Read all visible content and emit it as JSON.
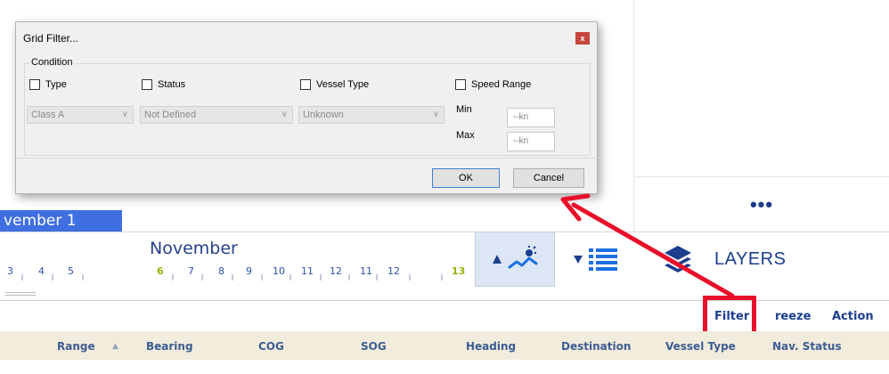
{
  "dialog": {
    "title": "Grid Filter...",
    "close_glyph": "x",
    "group_label": "Condition",
    "checkboxes": {
      "type": "Type",
      "status": "Status",
      "vessel_type": "Vessel Type",
      "speed_range": "Speed Range"
    },
    "combos": {
      "type": "Class A",
      "status": "Not Defined",
      "vessel_type": "Unknown"
    },
    "min_label": "Min",
    "max_label": "Max",
    "min_value": "--kn",
    "max_value": "--kn",
    "ok_label": "OK",
    "cancel_label": "Cancel"
  },
  "date_bar": {
    "selected_date": "vember 1"
  },
  "timeline": {
    "month": "November",
    "days": [
      "3",
      "4",
      "5",
      "6",
      "7",
      "8",
      "9",
      "10",
      "11",
      "12",
      "13"
    ],
    "highlighted_days": [
      "6",
      "13"
    ]
  },
  "side_panel": {
    "more_label": "•••",
    "layers_label": "LAYERS"
  },
  "toolbar": {
    "filter": "Filter",
    "freeze": "reeze",
    "action": "Action"
  },
  "grid": {
    "columns": [
      "Range",
      "Bearing",
      "COG",
      "SOG",
      "Heading",
      "Destination",
      "Vessel Type",
      "Nav. Status"
    ],
    "sort_glyph": "▲"
  },
  "colors": {
    "accent_blue": "#3f6fe0",
    "annotation_red": "#e8102a",
    "text_navy": "#1c3e8f",
    "header_bg": "#f1ecdc"
  }
}
